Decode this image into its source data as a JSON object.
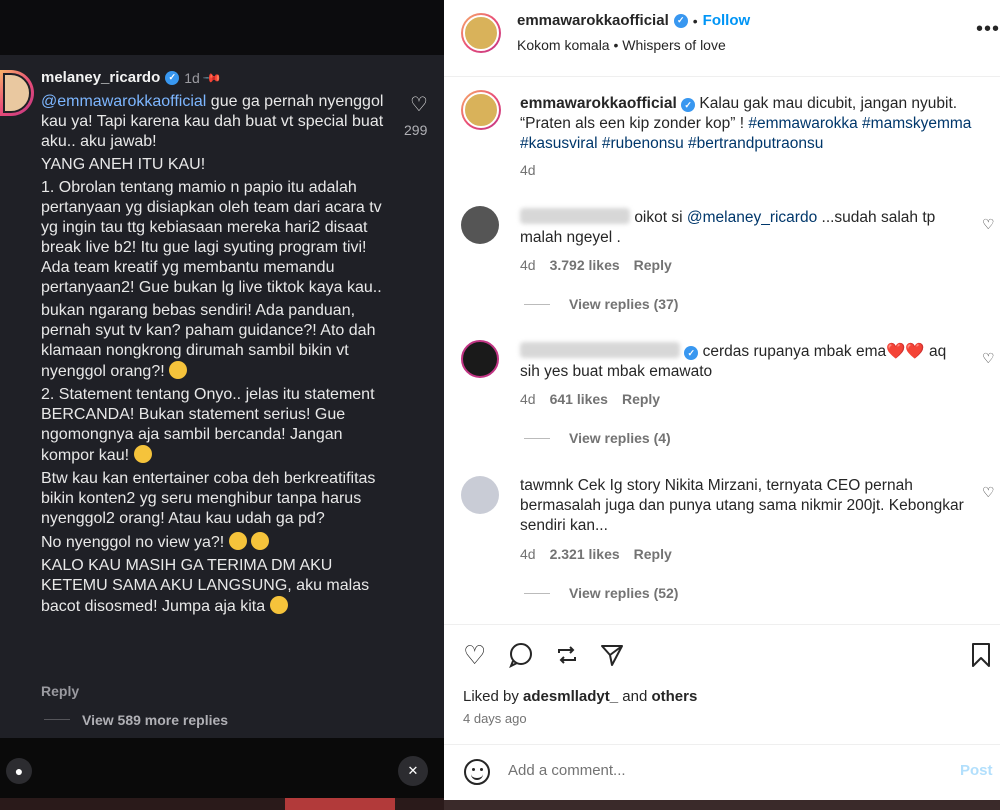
{
  "left_panel": {
    "username": "melaney_ricardo",
    "time": "1d",
    "mention": "@emmawarokkaofficial",
    "lines_first": "gue ga pernah nyenggol kau ya! Tapi karena kau dah buat vt special buat aku.. aku jawab!",
    "p2": "YANG ANEH ITU KAU!",
    "p3": "1. Obrolan tentang mamio n papio itu adalah pertanyaan yg disiapkan oleh team dari acara tv yg ingin tau ttg kebiasaan mereka hari2 disaat break live b2! Itu gue lagi syuting program tivi! Ada team kreatif yg membantu memandu pertanyaan2! Gue bukan lg live tiktok kaya kau..",
    "p4": "bukan ngarang bebas sendiri! Ada panduan, pernah syut tv kan? paham guidance?! Ato dah klamaan nongkrong dirumah sambil bikin vt nyenggol orang?!",
    "p5": "2. Statement tentang Onyo.. jelas itu statement BERCANDA! Bukan statement serius! Gue ngomongnya aja sambil bercanda! Jangan kompor kau!",
    "p6": "Btw kau kan entertainer coba deh berkreatifitas bikin konten2 yg seru menghibur tanpa harus nyenggol2 orang! Atau kau udah ga pd?",
    "p7": "No nyenggol no view ya?!",
    "p8": "KALO KAU MASIH GA TERIMA DM AKU KETEMU SAMA AKU LANGSUNG, aku malas bacot disosmed! Jumpa aja kita",
    "like_count": "299",
    "reply": "Reply",
    "view_more": "View 589 more replies"
  },
  "right_panel": {
    "header": {
      "username": "emmawarokkaofficial",
      "follow": "Follow",
      "subtitle": "Kokom komala • Whispers of love"
    },
    "caption": {
      "username": "emmawarokkaofficial",
      "text": "Kalau gak mau dicubit, jangan nyubit. “Praten als een kip zonder kop” !",
      "hashtags": "#emmawarokka #mamskyemma #kasusviral #rubenonsu #bertrandputraonsu",
      "time": "4d"
    },
    "comments": [
      {
        "text_tail": "oikot si",
        "mention": "@melaney_ricardo",
        "text_rest": "...sudah salah tp malah ngeyel .",
        "time": "4d",
        "likes": "3.792 likes",
        "reply": "Reply",
        "view_replies": "View replies (37)"
      },
      {
        "text_rest": "cerdas rupanya mbak ema❤️❤️ aq sih yes buat mbak emawato",
        "time": "4d",
        "likes": "641 likes",
        "reply": "Reply",
        "view_replies": "View replies (4)"
      },
      {
        "text_head": "tawmnk",
        "text_rest": "Cek Ig story Nikita Mirzani, ternyata CEO pernah bermasalah juga dan punya utang sama nikmir 200jt. Kebongkar sendiri kan...",
        "time": "4d",
        "likes": "2.321 likes",
        "reply": "Reply",
        "view_replies": "View replies (52)"
      }
    ],
    "liked_by_prefix": "Liked by",
    "liked_by_user": "adesmlladyt_",
    "liked_by_and": "and",
    "liked_by_others": "others",
    "posted_ago": "4 days ago",
    "add_comment_placeholder": "Add a comment...",
    "post_button": "Post",
    "icons": [
      "heart-icon",
      "comment-icon",
      "repost-icon",
      "share-icon",
      "bookmark-icon",
      "emoji-icon",
      "more-icon"
    ]
  }
}
